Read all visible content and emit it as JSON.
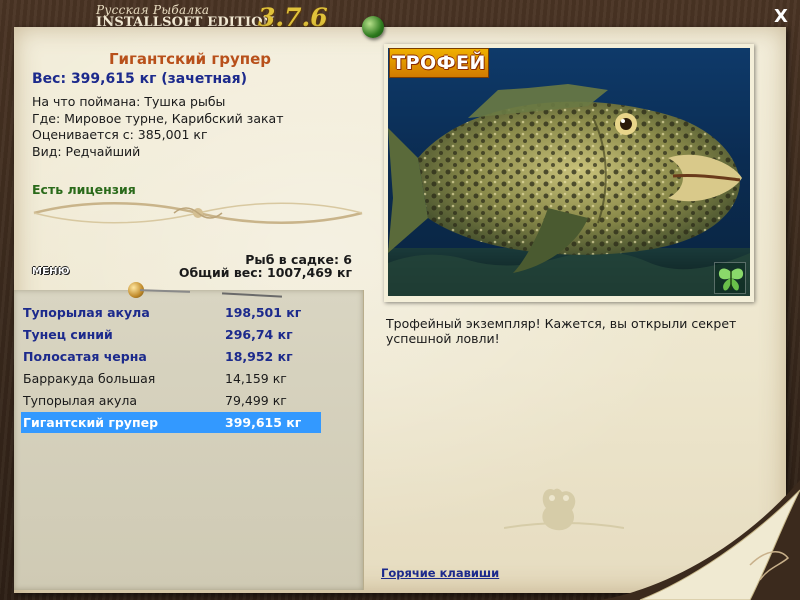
{
  "header": {
    "logo_sub": "Русская Рыбалка",
    "logo_main": "INSTALLSOFT EDITION",
    "logo_version": "3.7.6",
    "close_label": "X"
  },
  "fish": {
    "name": "Гигантский групер",
    "weight": "Вес: 399,615 кг (зачетная)",
    "details": [
      "На что поймана: Тушка рыбы",
      "Где: Мировое турне, Карибский закат",
      "Оценивается с: 385,001 кг",
      "Вид: Редчайший"
    ],
    "license": "Есть лицензия"
  },
  "summary": {
    "cage_count": "Рыб в садке: 6",
    "total_weight": "Общий вес: 1007,469 кг"
  },
  "menu_label": "МЕНЮ",
  "catch_list": [
    {
      "name": "Тупорылая акула",
      "weight": "198,501 кг",
      "style": "bold"
    },
    {
      "name": "Тунец синий",
      "weight": "296,74 кг",
      "style": "bold"
    },
    {
      "name": "Полосатая черна",
      "weight": "18,952 кг",
      "style": "bold"
    },
    {
      "name": "Барракуда большая",
      "weight": "14,159 кг",
      "style": "normal"
    },
    {
      "name": "Тупорылая акула",
      "weight": "79,499 кг",
      "style": "normal"
    },
    {
      "name": "Гигантский групер",
      "weight": "399,615 кг",
      "style": "selected"
    }
  ],
  "photo": {
    "badge": "ТРОФЕЙ"
  },
  "description": "Трофейный экземпляр! Кажется, вы открыли секрет успешной ловли!",
  "hotkeys_link": "Горячие клавиши",
  "colors": {
    "selected_row": "#3399ff",
    "fish_name": "#b8501a",
    "link_blue": "#1c2a8c",
    "license_green": "#2a6a1a",
    "trophy_gold": "#f0b000"
  }
}
